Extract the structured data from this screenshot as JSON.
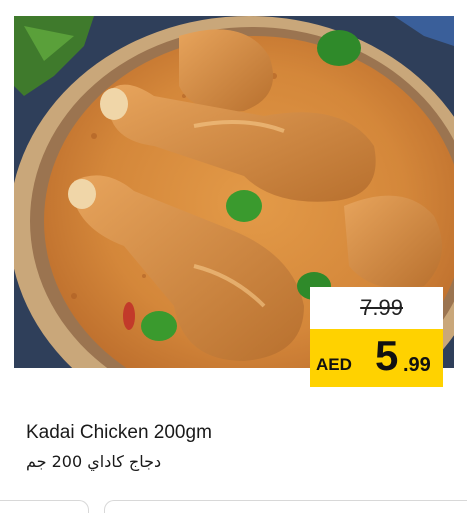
{
  "product": {
    "name_en": "Kadai Chicken 200gm",
    "name_ar": "دجاج كاداي 200 جم",
    "image_alt": "kadai-chicken-dish",
    "old_price": "7.99",
    "currency": "AED",
    "price_whole": "5",
    "price_decimal": ".99"
  },
  "colors": {
    "badge_yellow": "#ffd200",
    "curry": "#d98a3a",
    "bowl": "#c9a77a"
  }
}
